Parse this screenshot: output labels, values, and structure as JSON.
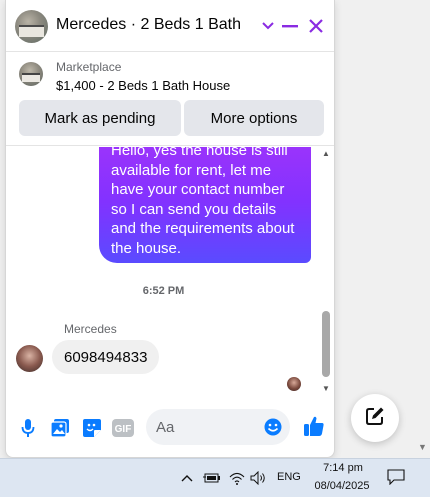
{
  "chat": {
    "title": "Mercedes · 2 Beds 1 Bath ...",
    "accent_color": "#8a2be2",
    "header_icons": [
      "chevron-down-icon",
      "minimize-icon",
      "close-icon"
    ]
  },
  "marketplace": {
    "label": "Marketplace",
    "item": "$1,400 - 2 Beds 1 Bath House",
    "buttons": {
      "pending": "Mark as pending",
      "more": "More options"
    }
  },
  "messages": {
    "outgoing_text": "Hello, yes the house is still available for rent, let me have your contact number so I can send you details and the requirements about the house.",
    "time": "6:52 PM",
    "sender": "Mercedes",
    "incoming_text": "6098494833"
  },
  "composer": {
    "placeholder": "Aa",
    "icons": [
      "microphone-icon",
      "photo-icon",
      "sticker-icon",
      "gif-icon",
      "emoji-icon",
      "thumbs-up-icon"
    ]
  },
  "taskbar": {
    "language": "ENG",
    "time": "7:14 pm",
    "date": "08/04/2025"
  }
}
